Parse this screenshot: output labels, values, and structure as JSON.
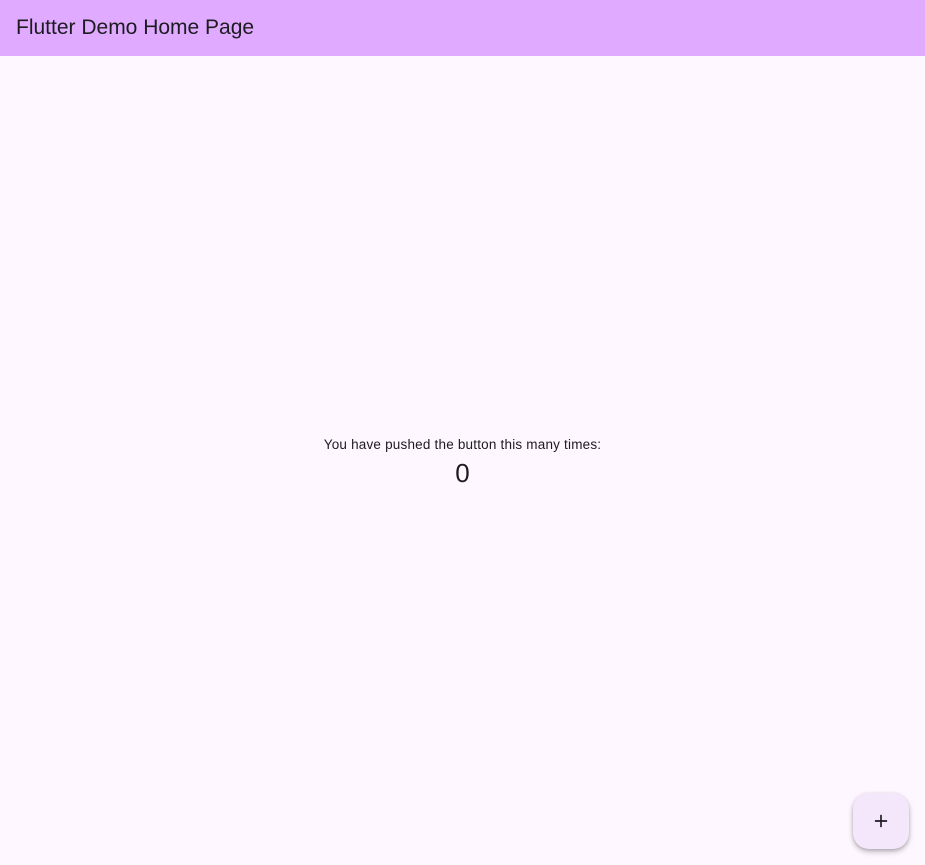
{
  "app_bar": {
    "title": "Flutter Demo Home Page"
  },
  "counter": {
    "label": "You have pushed the button this many times:",
    "value": "0"
  },
  "fab": {
    "icon": "plus-icon"
  },
  "colors": {
    "app_bar_background": "#dfaaff",
    "page_background": "#fef7ff",
    "fab_background": "#f4e7fb",
    "text": "#1d1b20"
  }
}
